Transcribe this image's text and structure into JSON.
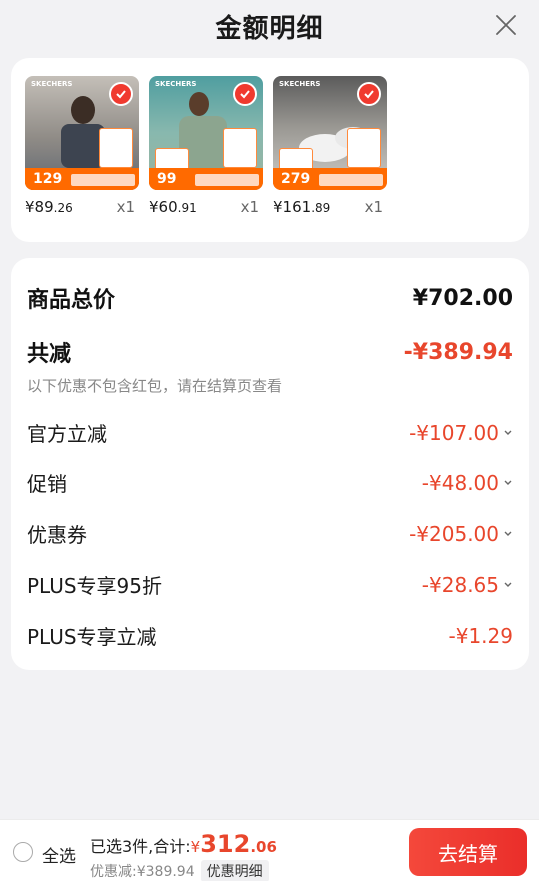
{
  "header": {
    "title": "金额明细"
  },
  "products": [
    {
      "thumb_price": "129",
      "price_int": "¥89",
      "price_dec": ".26",
      "qty": "x1",
      "bg": "#8a8f95",
      "brand": "SKECHERS"
    },
    {
      "thumb_price": "99",
      "price_int": "¥60",
      "price_dec": ".91",
      "qty": "x1",
      "bg": "#7fa1a0",
      "brand": "SKECHERS"
    },
    {
      "thumb_price": "279",
      "price_int": "¥161",
      "price_dec": ".89",
      "qty": "x1",
      "bg": "#c9c8c4",
      "brand": "SKECHERS"
    }
  ],
  "details": {
    "total_label": "商品总价",
    "total_value": "¥702.00",
    "reduce_label": "共减",
    "reduce_value": "-¥389.94",
    "note": "以下优惠不包含红包，请在结算页查看",
    "items": [
      {
        "label": "官方立减",
        "value": "-¥107.00"
      },
      {
        "label": "促销",
        "value": "-¥48.00"
      },
      {
        "label": "优惠券",
        "value": "-¥205.00"
      },
      {
        "label": "PLUS专享95折",
        "value": "-¥28.65"
      },
      {
        "label": "PLUS专享立减",
        "value": "-¥1.29"
      }
    ]
  },
  "bottom": {
    "select_all": "全选",
    "selected_text": "已选3件,合计:",
    "currency": "¥",
    "amount_int": "312",
    "amount_dec": ".06",
    "discount_text": "优惠减:¥389.94",
    "detail_chip": "优惠明细",
    "checkout": "去结算"
  },
  "colors": {
    "accent": "#e8462c",
    "button": "#f03a2f",
    "promo": "#ff6a00"
  }
}
